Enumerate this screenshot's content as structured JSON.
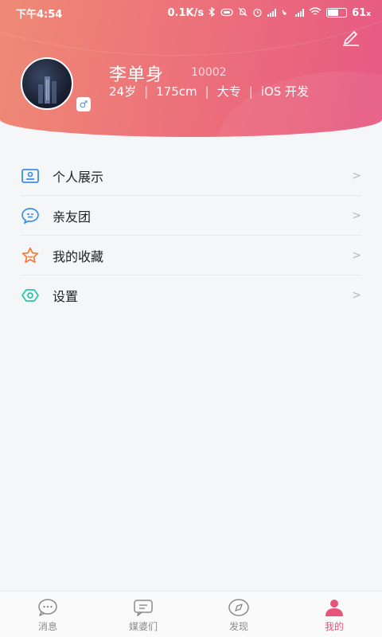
{
  "status_bar": {
    "time": "下午4:54",
    "speed": "0.1K/s",
    "battery_text": "61",
    "battery_level": 0.61
  },
  "profile": {
    "name": "李单身",
    "id": "10002",
    "age": "24岁",
    "height": "175cm",
    "education": "大专",
    "job": "iOS 开发",
    "gender_symbol": "♂"
  },
  "menu": {
    "items": [
      {
        "label": "个人展示",
        "icon": "profile-card-icon",
        "color": "#3a8ee6"
      },
      {
        "label": "亲友团",
        "icon": "chat-bubble-icon",
        "color": "#3a8ee6"
      },
      {
        "label": "我的收藏",
        "icon": "star-icon",
        "color": "#f27b3c"
      },
      {
        "label": "设置",
        "icon": "eye-settings-icon",
        "color": "#2cc6a8"
      }
    ],
    "arrow": ">"
  },
  "tabbar": {
    "tabs": [
      {
        "label": "消息",
        "icon": "message-icon"
      },
      {
        "label": "媒婆们",
        "icon": "matchmaker-icon"
      },
      {
        "label": "发现",
        "icon": "compass-icon"
      },
      {
        "label": "我的",
        "icon": "user-icon"
      }
    ],
    "active_index": 3,
    "active_color": "#e8557b"
  }
}
